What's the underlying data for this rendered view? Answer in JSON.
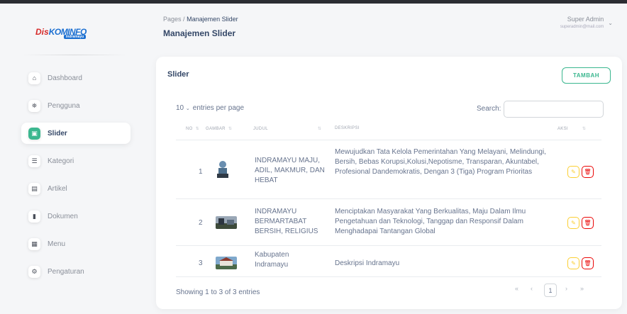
{
  "logo": {
    "part1": "Dis",
    "part2": "KOMINFO",
    "sub": "Indramayu"
  },
  "nav": [
    {
      "label": "Dashboard",
      "icon": "home-icon",
      "glyph": "⌂"
    },
    {
      "label": "Pengguna",
      "icon": "users-icon",
      "glyph": "⛯"
    },
    {
      "label": "Slider",
      "icon": "image-icon",
      "glyph": "▣"
    },
    {
      "label": "Kategori",
      "icon": "list-icon",
      "glyph": "☰"
    },
    {
      "label": "Artikel",
      "icon": "article-icon",
      "glyph": "▤"
    },
    {
      "label": "Dokumen",
      "icon": "document-icon",
      "glyph": "▮"
    },
    {
      "label": "Menu",
      "icon": "menu-icon",
      "glyph": "▦"
    },
    {
      "label": "Pengaturan",
      "icon": "settings-icon",
      "glyph": "⚙"
    }
  ],
  "header": {
    "breadcrumb_root": "Pages",
    "breadcrumb_sep": "/",
    "breadcrumb_current": "Manajemen Slider",
    "title": "Manajemen Slider",
    "user_name": "Super Admin",
    "user_email": "superadmin@mail.com"
  },
  "card": {
    "title": "Slider",
    "add_label": "TAMBAH",
    "length_value": "10",
    "length_suffix": "entries per page",
    "search_label": "Search:",
    "columns": [
      "NO",
      "GAMBAR",
      "JUDUL",
      "DESKRIPSI",
      "AKSI"
    ],
    "rows": [
      {
        "no": "1",
        "judul": "INDRAMAYU MAJU, ADIL, MAKMUR, DAN HEBAT",
        "deskripsi": "Mewujudkan Tata Kelola Pemerintahan Yang Melayani, Melindungi, Bersih, Bebas Korupsi,Kolusi,Nepotisme, Transparan, Akuntabel, Profesional Dandemokratis, Dengan 3 (Tiga) Program Prioritas"
      },
      {
        "no": "2",
        "judul": "INDRAMAYU BERMARTABAT BERSIH, RELIGIUS",
        "deskripsi": "Menciptakan Masyarakat Yang Berkualitas, Maju Dalam Ilmu Pengetahuan dan Teknologi, Tanggap dan Responsif Dalam Menghadapai Tantangan Global"
      },
      {
        "no": "3",
        "judul": "Kabupaten Indramayu",
        "deskripsi": "Deskripsi Indramayu"
      }
    ],
    "info": "Showing 1 to 3 of 3 entries",
    "pager": {
      "first": "«",
      "prev": "‹",
      "current": "1",
      "next": "›",
      "last": "»"
    }
  }
}
